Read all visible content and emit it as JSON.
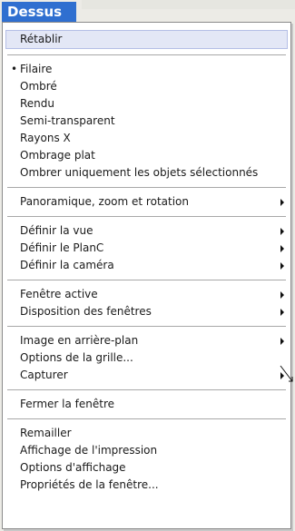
{
  "menu_title": "Dessus",
  "groups": [
    [
      {
        "label": "Rétablir",
        "highlight": true
      }
    ],
    [
      {
        "label": "Filaire",
        "checked": true
      },
      {
        "label": "Ombré"
      },
      {
        "label": "Rendu"
      },
      {
        "label": "Semi-transparent"
      },
      {
        "label": "Rayons X"
      },
      {
        "label": "Ombrage plat"
      },
      {
        "label": "Ombrer uniquement les objets sélectionnés"
      }
    ],
    [
      {
        "label": "Panoramique, zoom et rotation",
        "submenu": true
      }
    ],
    [
      {
        "label": "Définir la vue",
        "submenu": true
      },
      {
        "label": "Définir le PlanC",
        "submenu": true
      },
      {
        "label": "Définir la caméra",
        "submenu": true
      }
    ],
    [
      {
        "label": "Fenêtre active",
        "submenu": true
      },
      {
        "label": "Disposition des fenêtres",
        "submenu": true
      }
    ],
    [
      {
        "label": "Image en arrière-plan",
        "submenu": true
      },
      {
        "label": "Options de la grille..."
      },
      {
        "label": "Capturer",
        "submenu": true
      }
    ],
    [
      {
        "label": "Fermer la fenêtre"
      }
    ],
    [
      {
        "label": "Remailler"
      },
      {
        "label": "Affichage de l'impression"
      },
      {
        "label": "Options d'affichage"
      },
      {
        "label": "Propriétés de la fenêtre..."
      }
    ]
  ],
  "check_glyph": "•"
}
